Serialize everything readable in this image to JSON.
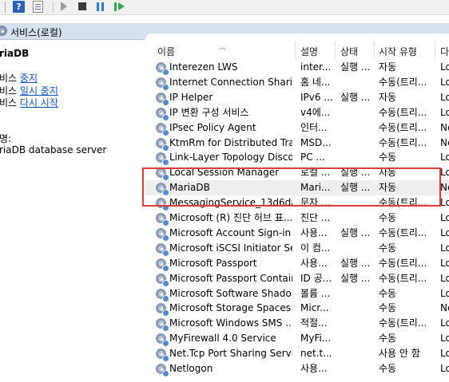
{
  "toolbar": {
    "help_label": "?"
  },
  "header": {
    "title": "서비스(로컬)"
  },
  "left_pane": {
    "service_name": "riaDB",
    "actions": [
      {
        "prefix": "비스 ",
        "link": "중지"
      },
      {
        "prefix": "비스 ",
        "link": "일시 중지"
      },
      {
        "prefix": "비스 ",
        "link": "다시 시작"
      }
    ],
    "description_label": "명:",
    "description_text": "riaDB database server"
  },
  "columns": {
    "name": "이름",
    "description": "설명",
    "status": "상태",
    "startup_type": "시작 유형",
    "logon": "다"
  },
  "services": [
    {
      "name": "Interezen LWS",
      "description": "inter...",
      "status": "실행 ...",
      "startup": "자동",
      "logon": "Lo"
    },
    {
      "name": "Internet Connection Sharin...",
      "description": "홈 네...",
      "status": "",
      "startup": "수동(트리...",
      "logon": "Lo"
    },
    {
      "name": "IP Helper",
      "description": "IPv6 ...",
      "status": "실행 ...",
      "startup": "자동",
      "logon": "Lo"
    },
    {
      "name": "IP 변환 구성 서비스",
      "description": "v4에...",
      "status": "",
      "startup": "수동(트리...",
      "logon": "Lo"
    },
    {
      "name": "IPsec Policy Agent",
      "description": "인터...",
      "status": "",
      "startup": "수동(트리...",
      "logon": "Ne"
    },
    {
      "name": "KtmRm for Distributed Tra...",
      "description": "MSD...",
      "status": "",
      "startup": "수동(트리...",
      "logon": "Ne"
    },
    {
      "name": "Link-Layer Topology Disco...",
      "description": "PC ...",
      "status": "",
      "startup": "수동",
      "logon": "Lo"
    },
    {
      "name": "Local Session Manager",
      "description": "로컬 ...",
      "status": "실행 ...",
      "startup": "자동",
      "logon": "Lo"
    },
    {
      "name": "MariaDB",
      "description": "Mari...",
      "status": "실행 ...",
      "startup": "자동",
      "logon": "Ne"
    },
    {
      "name": "MessagingService_13d6da...",
      "description": "문자 ...",
      "status": "",
      "startup": "수동(트리...",
      "logon": "Lo"
    },
    {
      "name": "Microsoft (R) 진단 허브 표...",
      "description": "진단 ...",
      "status": "",
      "startup": "수동",
      "logon": "Lo"
    },
    {
      "name": "Microsoft Account Sign-in ...",
      "description": "사용...",
      "status": "실행 ...",
      "startup": "수동(트리...",
      "logon": "Lo"
    },
    {
      "name": "Microsoft iSCSI Initiator Se...",
      "description": "이 컴...",
      "status": "",
      "startup": "수동",
      "logon": "Lo"
    },
    {
      "name": "Microsoft Passport",
      "description": "사용...",
      "status": "실행 ...",
      "startup": "수동(트리...",
      "logon": "Lo"
    },
    {
      "name": "Microsoft Passport Container",
      "description": "ID 공...",
      "status": "실행 ...",
      "startup": "수동(트리...",
      "logon": "Lo"
    },
    {
      "name": "Microsoft Software Shado...",
      "description": "볼륨 ...",
      "status": "",
      "startup": "수동",
      "logon": "Lo"
    },
    {
      "name": "Microsoft Storage Spaces ...",
      "description": "Micr...",
      "status": "",
      "startup": "수동",
      "logon": "Ne"
    },
    {
      "name": "Microsoft Windows SMS ...",
      "description": "적절...",
      "status": "",
      "startup": "수동(트리...",
      "logon": "Lo"
    },
    {
      "name": "MyFirewall 4.0 Service",
      "description": "MyFi...",
      "status": "",
      "startup": "수동",
      "logon": "Lo"
    },
    {
      "name": "Net.Tcp Port Sharing Service",
      "description": "net.t...",
      "status": "",
      "startup": "사용 안 함",
      "logon": "Lo"
    },
    {
      "name": "Netlogon",
      "description": "사용...",
      "status": "",
      "startup": "수동",
      "logon": "Lo"
    }
  ]
}
